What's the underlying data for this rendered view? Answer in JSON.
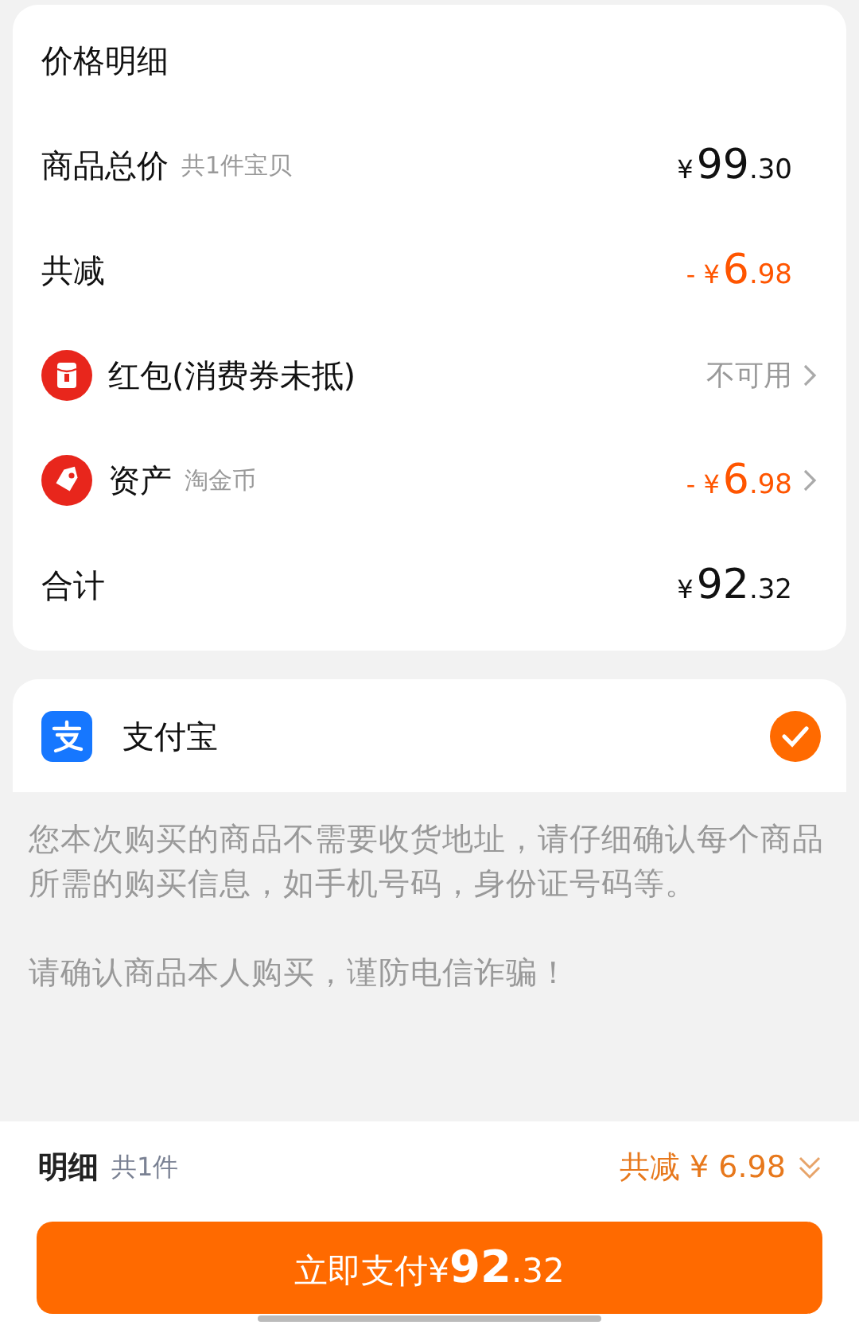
{
  "price_detail": {
    "title": "价格明细",
    "rows": [
      {
        "kind": "plain",
        "label": "商品总价",
        "note": "共1件宝贝",
        "value": {
          "color": "#111111",
          "prefix": "¥",
          "main": "99",
          "fraction": ".30"
        },
        "chevron": false
      },
      {
        "kind": "plain",
        "label": "共减",
        "value": {
          "color": "#ff5500",
          "prefix": "- ¥",
          "main": "6",
          "fraction": ".98"
        },
        "chevron": false
      },
      {
        "kind": "red-packet",
        "label": "红包(消费券未抵)",
        "value": {
          "color": "#999999",
          "text": "不可用"
        },
        "chevron": true
      },
      {
        "kind": "tag",
        "label": "资产",
        "note": "淘金币",
        "value": {
          "color": "#ff5500",
          "prefix": "- ¥",
          "main": "6",
          "fraction": ".98"
        },
        "chevron": true
      },
      {
        "kind": "plain",
        "label": "合计",
        "value": {
          "color": "#111111",
          "prefix": "¥",
          "main": "92",
          "fraction": ".32"
        },
        "chevron": false
      }
    ]
  },
  "payment": {
    "name": "支付宝",
    "selected": true
  },
  "notices": [
    "您本次购买的商品不需要收货地址，请仔细确认每个商品所需的购买信息，如手机号码，身份证号码等。",
    "请确认商品本人购买，谨防电信诈骗！"
  ],
  "footer": {
    "label": "明细",
    "count": "共1件",
    "discount": "共减 ¥ 6.98",
    "expanded": false,
    "pay_button": {
      "label": "立即支付",
      "prefix": "¥",
      "main": "92",
      "fraction": ".32"
    }
  }
}
